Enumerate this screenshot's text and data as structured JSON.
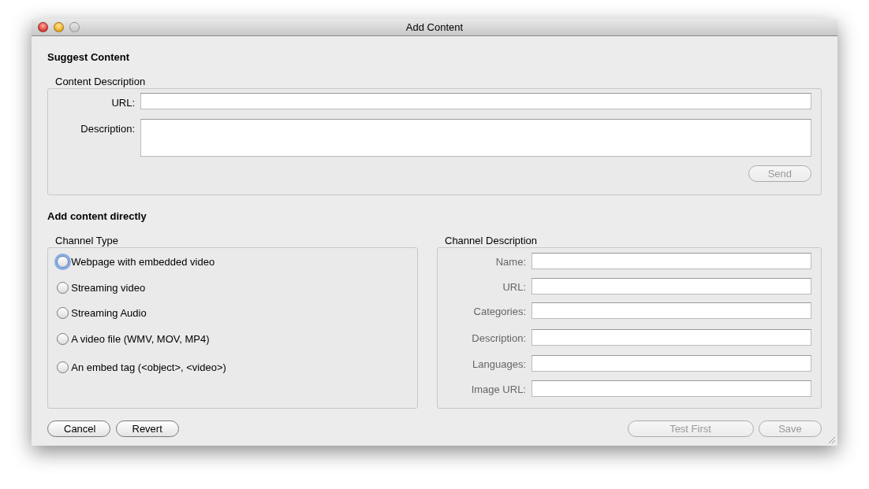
{
  "window": {
    "title": "Add Content",
    "controls": [
      {
        "kind": "close",
        "disabled": false
      },
      {
        "kind": "minimize",
        "disabled": false
      },
      {
        "kind": "zoom",
        "disabled": true
      }
    ]
  },
  "suggest": {
    "heading": "Suggest Content",
    "group_title": "Content Description",
    "fields": [
      {
        "label": "URL:",
        "kind": "line"
      },
      {
        "label": "Description:",
        "kind": "area"
      }
    ],
    "send_button": {
      "label": "Send",
      "disabled": true
    }
  },
  "direct": {
    "heading": "Add content directly",
    "channel_type": {
      "title": "Channel Type",
      "options": [
        {
          "label": "Webpage with embedded video",
          "selected": false,
          "focused": true
        },
        {
          "label": "Streaming video",
          "selected": false,
          "focused": false
        },
        {
          "label": "Streaming Audio",
          "selected": false,
          "focused": false
        },
        {
          "label": "A video file (WMV, MOV, MP4)",
          "selected": false,
          "focused": false
        },
        {
          "label": "An embed tag (<object>, <video>)",
          "selected": false,
          "focused": false
        }
      ]
    },
    "channel_description": {
      "title": "Channel Description",
      "disabled": true,
      "fields": [
        {
          "label": "Name:"
        },
        {
          "label": "URL:"
        },
        {
          "label": "Categories:"
        },
        {
          "label": "Description:"
        },
        {
          "label": "Languages:"
        },
        {
          "label": "Image URL:"
        }
      ]
    }
  },
  "buttons_left": [
    {
      "label": "Cancel",
      "disabled": false
    },
    {
      "label": "Revert",
      "disabled": false
    }
  ],
  "buttons_right": [
    {
      "label": "Test First",
      "disabled": true
    },
    {
      "label": "Save",
      "disabled": true
    }
  ]
}
